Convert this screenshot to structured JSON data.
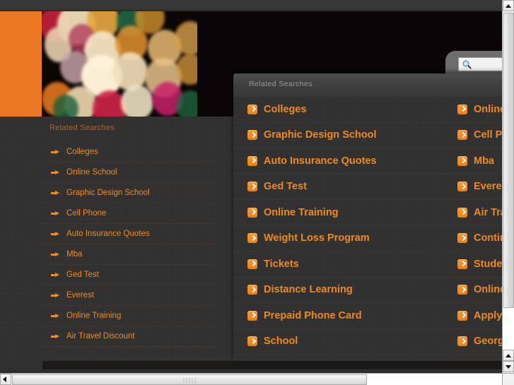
{
  "header": {
    "banner_alt": "bokeh-lights-banner",
    "search": {
      "icon": "magnifier-icon",
      "value": "",
      "placeholder": ""
    }
  },
  "background_page": {
    "heading": "Related Searches",
    "items": [
      {
        "label": "Colleges"
      },
      {
        "label": "Online School"
      },
      {
        "label": "Graphic Design School"
      },
      {
        "label": "Cell Phone"
      },
      {
        "label": "Auto Insurance Quotes"
      },
      {
        "label": "Mba"
      },
      {
        "label": "Ged Test"
      },
      {
        "label": "Everest"
      },
      {
        "label": "Online Training"
      },
      {
        "label": "Air Travel Discount"
      }
    ]
  },
  "overlay": {
    "title": "Related Searches",
    "left_column": [
      {
        "label": "Colleges"
      },
      {
        "label": "Graphic Design School"
      },
      {
        "label": "Auto Insurance Quotes"
      },
      {
        "label": "Ged Test"
      },
      {
        "label": "Online Training"
      },
      {
        "label": "Weight Loss Program"
      },
      {
        "label": "Tickets"
      },
      {
        "label": "Distance Learning"
      },
      {
        "label": "Prepaid Phone Card"
      },
      {
        "label": "School"
      }
    ],
    "right_column": [
      {
        "label": "Online"
      },
      {
        "label": "Cell Ph"
      },
      {
        "label": "Mba"
      },
      {
        "label": "Everest"
      },
      {
        "label": "Air Trav"
      },
      {
        "label": "Continu"
      },
      {
        "label": "Studen"
      },
      {
        "label": "Online"
      },
      {
        "label": "Apply C"
      },
      {
        "label": "Georgia"
      }
    ]
  },
  "colors": {
    "accent_orange": "#ef8b22",
    "header_orange": "#ec7722",
    "page_bg": "#313131",
    "overlay_header": "#4c4c4c",
    "muted_text": "#9b9b9b",
    "bg_heading": "#b4622c"
  },
  "scrollbars": {
    "vertical_up_icon": "triangle-up-icon",
    "vertical_down_icon": "triangle-down-icon",
    "horizontal_left_icon": "triangle-left-icon"
  }
}
